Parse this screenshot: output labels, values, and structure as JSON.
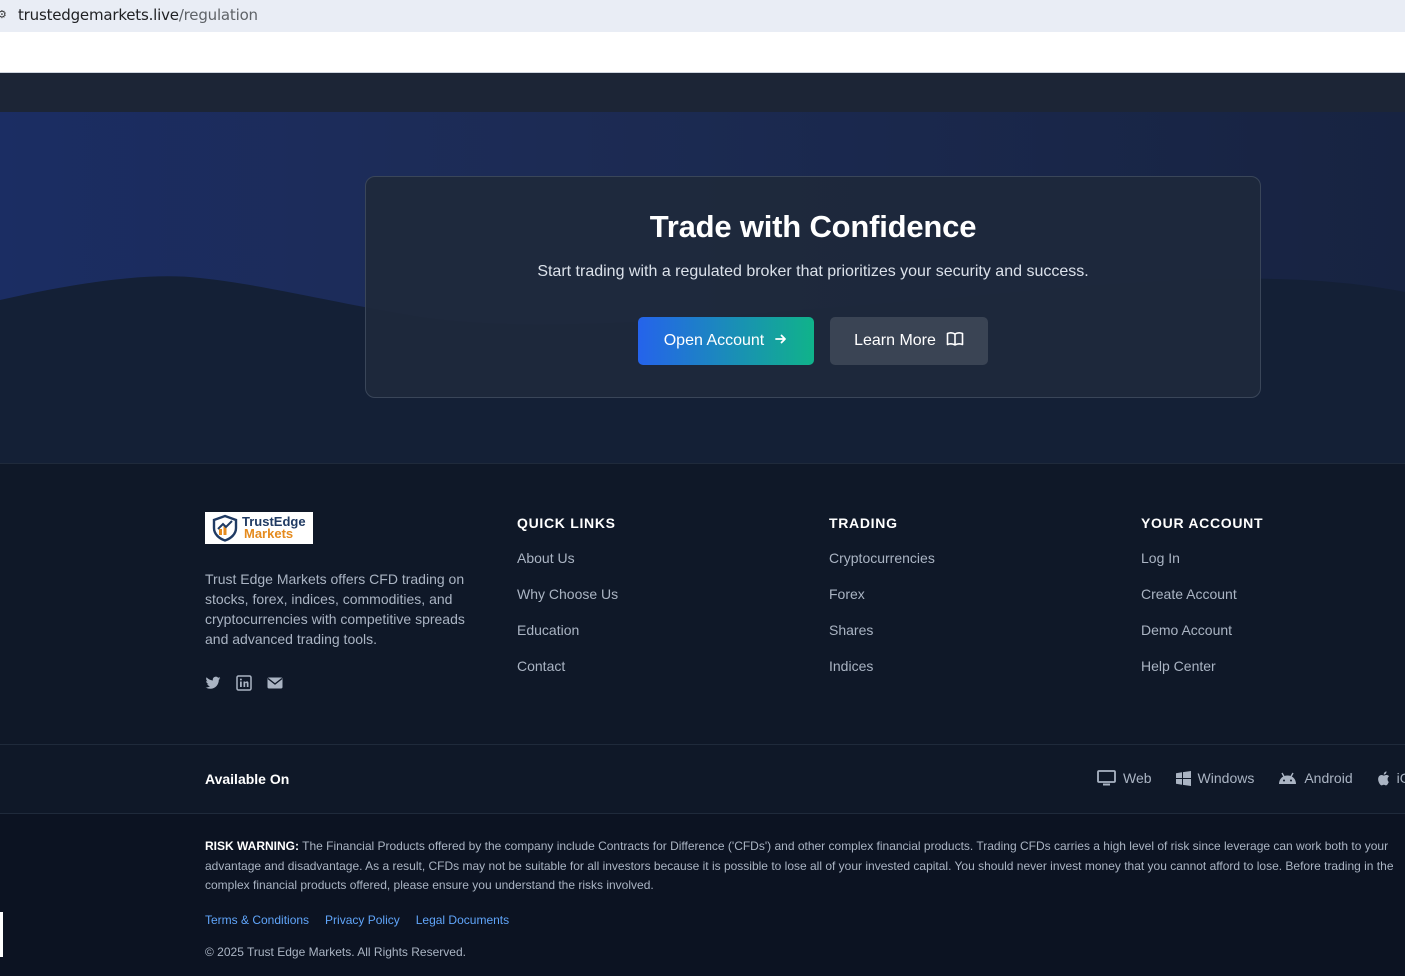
{
  "browser": {
    "url_domain": "trustedgemarkets.live",
    "url_path": "/regulation"
  },
  "cta": {
    "title": "Trade with Confidence",
    "subtitle": "Start trading with a regulated broker that prioritizes your security and success.",
    "open_account_label": "Open Account",
    "learn_more_label": "Learn More"
  },
  "footer": {
    "logo_line1": "TrustEdge",
    "logo_line2": "Markets",
    "about": "Trust Edge Markets offers CFD trading on stocks, forex, indices, commodities, and cryptocurrencies with competitive spreads and advanced trading tools.",
    "quick_links": {
      "heading": "QUICK LINKS",
      "items": [
        "About Us",
        "Why Choose Us",
        "Education",
        "Contact"
      ]
    },
    "trading": {
      "heading": "TRADING",
      "items": [
        "Cryptocurrencies",
        "Forex",
        "Shares",
        "Indices"
      ]
    },
    "account": {
      "heading": "YOUR ACCOUNT",
      "items": [
        "Log In",
        "Create Account",
        "Demo Account",
        "Help Center"
      ]
    }
  },
  "availability": {
    "label": "Available On",
    "platforms": [
      "Web",
      "Windows",
      "Android",
      "iOS"
    ]
  },
  "legal": {
    "risk_label": "RISK WARNING:",
    "risk_text": "The Financial Products offered by the company include Contracts for Difference ('CFDs') and other complex financial products. Trading CFDs carries a high level of risk since leverage can work both to your advantage and disadvantage. As a result, CFDs may not be suitable for all investors because it is possible to lose all of your invested capital. You should never invest money that you cannot afford to lose. Before trading in the complex financial products offered, please ensure you understand the risks involved.",
    "links": [
      "Terms & Conditions",
      "Privacy Policy",
      "Legal Documents"
    ],
    "copyright": "© 2025 Trust Edge Markets. All Rights Reserved."
  },
  "colors": {
    "accent_blue": "#2563eb",
    "accent_green": "#10b38a",
    "link_blue": "#60a5fa",
    "background": "#0f1828"
  }
}
